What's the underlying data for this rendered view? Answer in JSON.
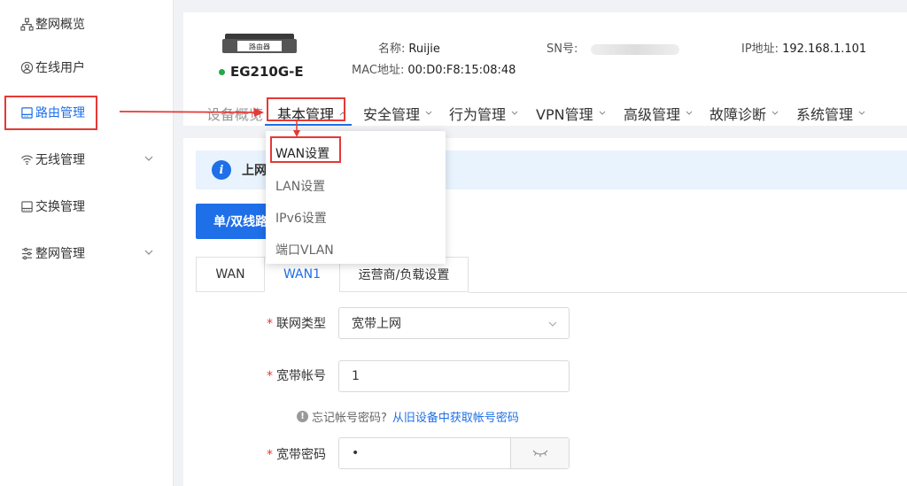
{
  "sidebar": {
    "items": [
      {
        "label": "整网概览",
        "icon": "topology-icon",
        "active": false,
        "expandable": false
      },
      {
        "label": "在线用户",
        "icon": "user-icon",
        "active": false,
        "expandable": false
      },
      {
        "label": "路由管理",
        "icon": "router-icon",
        "active": true,
        "expandable": false
      },
      {
        "label": "无线管理",
        "icon": "wifi-icon",
        "active": false,
        "expandable": true
      },
      {
        "label": "交换管理",
        "icon": "switch-icon",
        "active": false,
        "expandable": false
      },
      {
        "label": "整网管理",
        "icon": "network-settings-icon",
        "active": false,
        "expandable": true
      }
    ]
  },
  "device": {
    "badge": "路由器",
    "model": "EG210G-E",
    "status_color": "#22a847",
    "name_label": "名称:",
    "name_value": "Ruijie",
    "mac_label": "MAC地址:",
    "mac_value": "00:D0:F8:15:08:48",
    "sn_label": "SN号:",
    "sn_value": "",
    "ip_label": "IP地址:",
    "ip_value": "192.168.1.101"
  },
  "nav": {
    "items": [
      {
        "label": "设备概览",
        "has_caret": false
      },
      {
        "label": "基本管理",
        "has_caret": true,
        "active": true
      },
      {
        "label": "安全管理",
        "has_caret": true
      },
      {
        "label": "行为管理",
        "has_caret": true
      },
      {
        "label": "VPN管理",
        "has_caret": true
      },
      {
        "label": "高级管理",
        "has_caret": true
      },
      {
        "label": "故障诊断",
        "has_caret": true
      },
      {
        "label": "系统管理",
        "has_caret": true
      }
    ]
  },
  "dropdown": {
    "items": [
      "WAN设置",
      "LAN设置",
      "IPv6设置",
      "端口VLAN"
    ]
  },
  "alert": {
    "text": "上网"
  },
  "primary_button": {
    "label": "单/双线路"
  },
  "tabs": [
    {
      "label": "WAN",
      "active": false
    },
    {
      "label": "WAN1",
      "active": true
    },
    {
      "label": "运营商/负载设置",
      "active": false
    }
  ],
  "form": {
    "type_label": "联网类型",
    "type_value": "宽带上网",
    "account_label": "宽带帐号",
    "account_value": "1",
    "hint_text": "忘记帐号密码?",
    "hint_link": "从旧设备中获取帐号密码",
    "password_label": "宽带密码",
    "password_value": "•"
  },
  "colors": {
    "accent": "#1e6fe8",
    "annotation": "#e53935"
  }
}
